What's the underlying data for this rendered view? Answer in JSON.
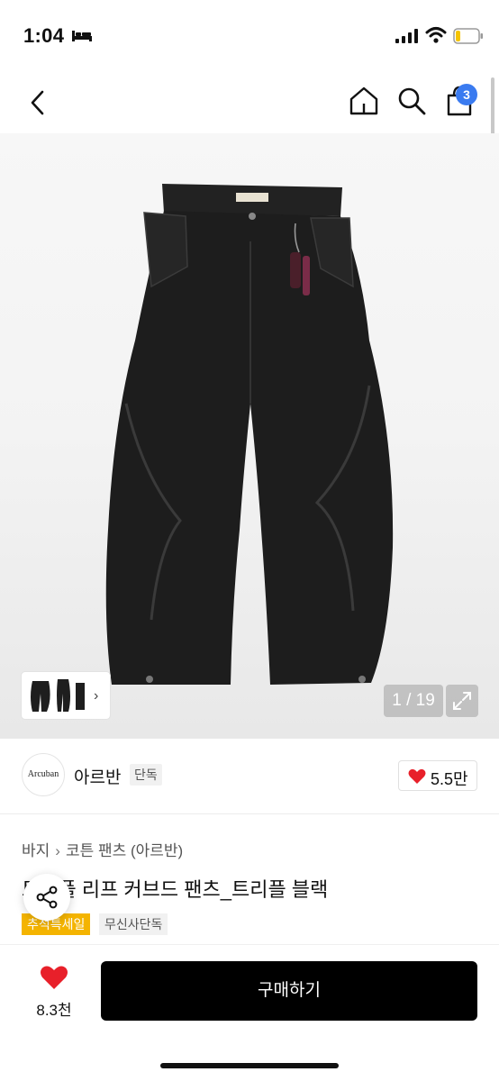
{
  "status_bar": {
    "time": "1:04",
    "icons": [
      "bed-icon",
      "signal-icon",
      "wifi-icon",
      "battery-icon"
    ]
  },
  "header": {
    "icons": [
      "back-icon",
      "home-icon",
      "search-icon",
      "cart-icon"
    ],
    "cart_count": "3"
  },
  "gallery": {
    "counter": "1 / 19",
    "image": "black curved cotton pants",
    "expand_icon": "expand-icon",
    "thumb_arrow": "›"
  },
  "brand": {
    "logo_text": "Arcuban",
    "name": "아르반",
    "badge": "단독",
    "like_count": "5.5만"
  },
  "product": {
    "breadcrumb": [
      "바지",
      "코튼 팬츠 (아르반)"
    ],
    "breadcrumb_sep": "›",
    "title": "트리플 리프 커브드 팬츠_트리플 블랙",
    "tags": [
      "추석특세일",
      "무신사단독"
    ]
  },
  "bottom_bar": {
    "wish_count": "8.3천",
    "buy_label": "구매하기"
  },
  "colors": {
    "accent_badge": "#3a7bf0",
    "heart": "#e8202a",
    "promo_tag": "#f4b400",
    "buy_button": "#000000"
  }
}
